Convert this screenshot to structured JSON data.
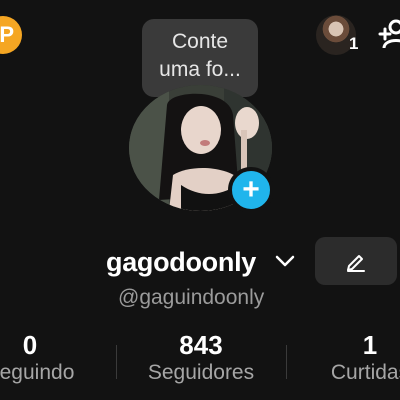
{
  "top_bar": {
    "coin_icon": "coin-icon",
    "coin_glyph": "P",
    "story_count": "1",
    "add_friend_icon": "add-friend-icon"
  },
  "tooltip": {
    "line1": "Conte",
    "line2": "uma fo..."
  },
  "profile": {
    "add_photo_glyph": "+",
    "username": "gagodoonly",
    "handle": "@gaguindoonly",
    "edit_icon": "pencil-icon"
  },
  "stats": [
    {
      "value": "0",
      "label": "Seguindo"
    },
    {
      "value": "843",
      "label": "Seguidores"
    },
    {
      "value": "1",
      "label": "Curtidas"
    }
  ],
  "colors": {
    "background": "#121212",
    "accent": "#20b5ec",
    "coin": "#f5a623"
  }
}
